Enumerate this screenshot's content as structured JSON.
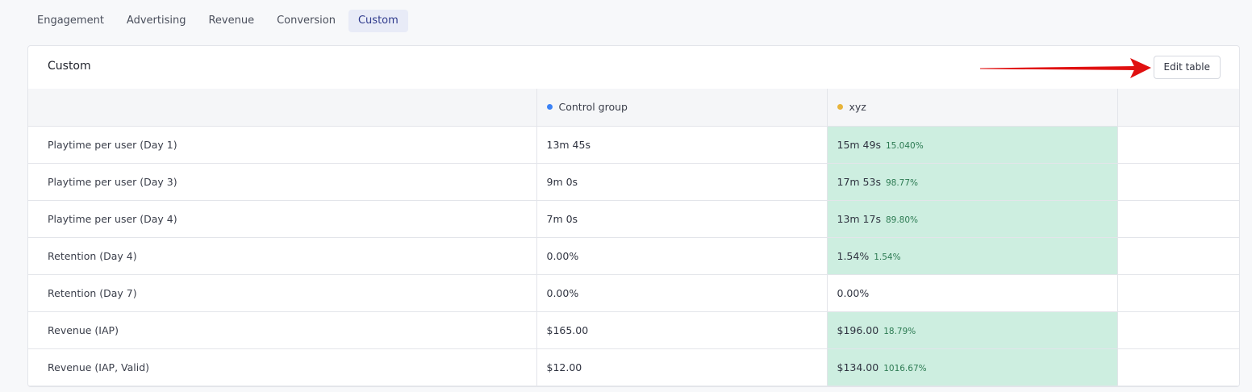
{
  "tabs": [
    {
      "label": "Engagement"
    },
    {
      "label": "Advertising"
    },
    {
      "label": "Revenue"
    },
    {
      "label": "Conversion"
    },
    {
      "label": "Custom",
      "active": true
    }
  ],
  "card": {
    "title": "Custom",
    "edit_button": "Edit table"
  },
  "columns": [
    {
      "label": "Control group",
      "dot_color": "#3b82f6"
    },
    {
      "label": "xyz",
      "dot_color": "#e8b43a"
    }
  ],
  "rows": [
    {
      "metric": "Playtime per user (Day 1)",
      "control": "13m 45s",
      "variant": "15m 49s",
      "delta": "15.040%",
      "highlight": true
    },
    {
      "metric": "Playtime per user (Day 3)",
      "control": "9m 0s",
      "variant": "17m 53s",
      "delta": "98.77%",
      "highlight": true
    },
    {
      "metric": "Playtime per user (Day 4)",
      "control": "7m 0s",
      "variant": "13m 17s",
      "delta": "89.80%",
      "highlight": true
    },
    {
      "metric": "Retention (Day 4)",
      "control": "0.00%",
      "variant": "1.54%",
      "delta": "1.54%",
      "highlight": true
    },
    {
      "metric": "Retention (Day 7)",
      "control": "0.00%",
      "variant": "0.00%",
      "delta": "",
      "highlight": false
    },
    {
      "metric": "Revenue (IAP)",
      "control": "$165.00",
      "variant": "$196.00",
      "delta": "18.79%",
      "highlight": true
    },
    {
      "metric": "Revenue (IAP, Valid)",
      "control": "$12.00",
      "variant": "$134.00",
      "delta": "1016.67%",
      "highlight": true
    }
  ],
  "colors": {
    "highlight": "#cdeee0",
    "delta_text": "#2c7a52",
    "arrow": "#e01010",
    "active_tab_bg": "#e8ebf7"
  },
  "annotation": {
    "icon": "red-arrow-icon"
  }
}
